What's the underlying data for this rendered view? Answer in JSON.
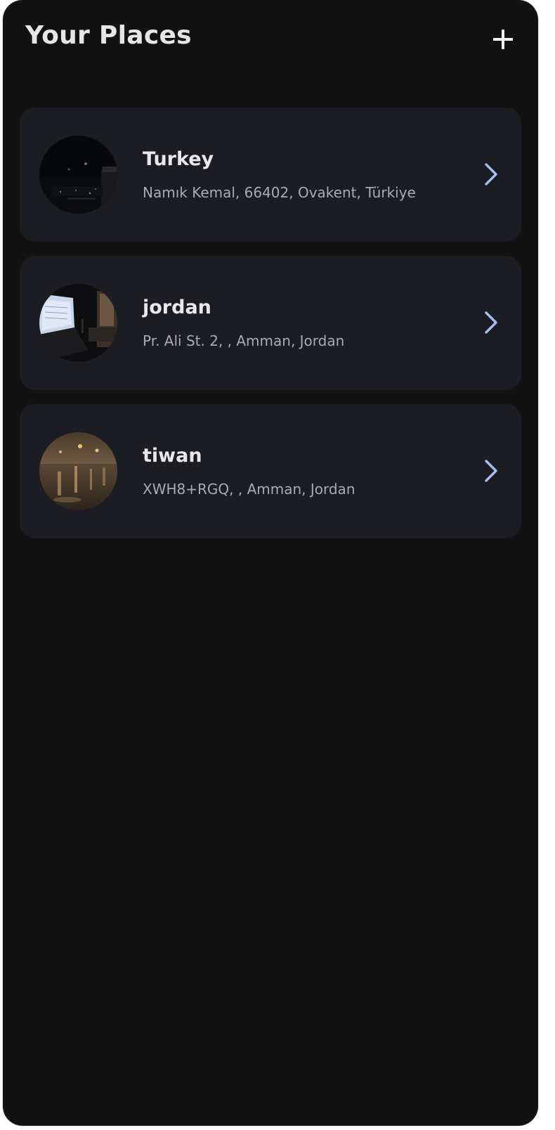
{
  "app_bar": {
    "title": "Your Places",
    "add_icon": "plus-icon"
  },
  "colors": {
    "background": "#121212",
    "card": "#1c1d23",
    "title_text": "#e6e6e8",
    "subtitle_text": "#a9aab2",
    "chevron": "#a8bdf3"
  },
  "places": [
    {
      "title": "Turkey",
      "address": "Namık Kemal, 66402, Ovakent, Türkiye",
      "thumbnail": "night-city-photo",
      "trailing_icon": "chevron-right-icon"
    },
    {
      "title": "jordan",
      "address": "Pr. Ali St. 2, , Amman, Jordan",
      "thumbnail": "laptop-desk-photo",
      "trailing_icon": "chevron-right-icon"
    },
    {
      "title": "tiwan",
      "address": "XWH8+RGQ, , Amman, Jordan",
      "thumbnail": "wet-street-night-photo",
      "trailing_icon": "chevron-right-icon"
    }
  ]
}
